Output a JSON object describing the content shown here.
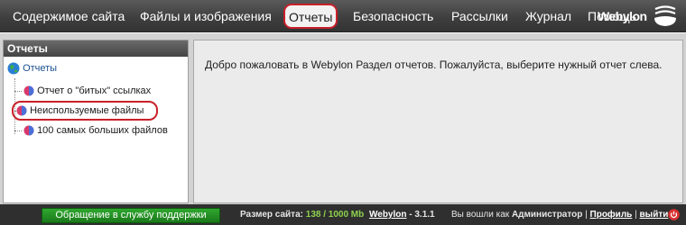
{
  "nav": {
    "items": [
      {
        "label": "Содержимое сайта"
      },
      {
        "label": "Файлы и изображения"
      },
      {
        "label": "Отчеты",
        "active": true
      },
      {
        "label": "Безопасность"
      },
      {
        "label": "Рассылки"
      },
      {
        "label": "Журнал"
      },
      {
        "label": "Помощь"
      }
    ],
    "brand": "Webylon",
    "brand_icon": "webylon-cup-icon"
  },
  "left_panel": {
    "title": "Отчеты",
    "root": {
      "label": "Отчеты",
      "icon": "globe-icon"
    },
    "items": [
      {
        "label": "Отчет о \"битых\" ссылках",
        "icon": "report-icon"
      },
      {
        "label": "Неиспользуемые файлы",
        "icon": "report-icon",
        "highlighted": true
      },
      {
        "label": "100 самых больших файлов",
        "icon": "report-icon"
      }
    ]
  },
  "main": {
    "welcome_text": "Добро пожаловать в Webylon Раздел отчетов. Пожалуйста, выберите нужный отчет слева."
  },
  "footer": {
    "support_button": "Обращение в службу поддержки",
    "site_size_label": "Размер сайта:",
    "site_size_value": "138 / 1000 Mb",
    "product_link": "Webylon",
    "version": "3.1.1",
    "logged_in_prefix": "Вы вошли как",
    "user_name": "Администратор",
    "profile_link": "Профиль",
    "logout_link": "выйти",
    "power_icon": "power-icon"
  },
  "colors": {
    "highlight_ring": "#c8202a",
    "topbar": "#3f3f3f",
    "content_bg": "#d2d2d2",
    "support_green": "#1a7a1a",
    "size_green": "#8fd14f"
  }
}
